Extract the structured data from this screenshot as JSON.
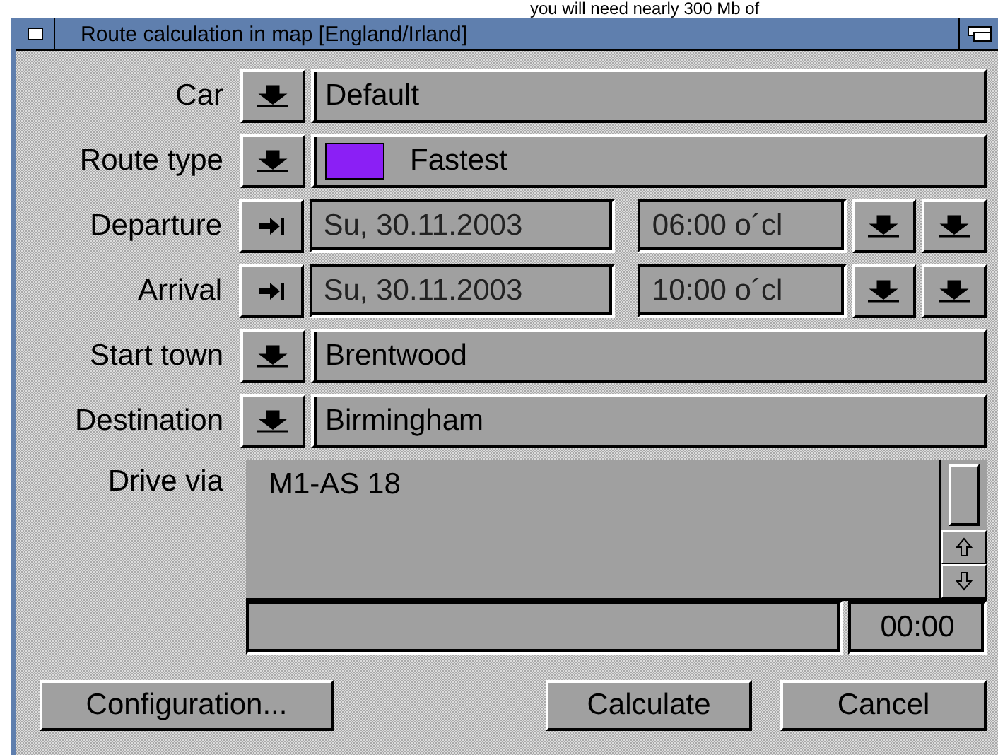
{
  "background_text": "you will need nearly 300 Mb of",
  "window": {
    "title": "Route calculation in map [England/Irland]"
  },
  "fields": [
    {
      "kind": "select",
      "label": "Car",
      "value": "Default"
    },
    {
      "kind": "select",
      "label": "Route type",
      "value": "Fastest",
      "color": "#8b1ff5"
    },
    {
      "kind": "datetime",
      "label": "Departure",
      "date": "Su, 30.11.2003",
      "time": "06:00 o´cl"
    },
    {
      "kind": "datetime",
      "label": "Arrival",
      "date": "Su, 30.11.2003",
      "time": "10:00 o´cl"
    },
    {
      "kind": "select",
      "label": "Start town",
      "value": "Brentwood"
    },
    {
      "kind": "select",
      "label": "Destination",
      "value": "Birmingham"
    }
  ],
  "drive_via": {
    "label": "Drive via",
    "items": [
      "M1-AS 18"
    ]
  },
  "status": {
    "time": "00:00"
  },
  "buttons": [
    {
      "label": "Configuration..."
    },
    {
      "label": "Calculate"
    },
    {
      "label": "Cancel"
    }
  ]
}
